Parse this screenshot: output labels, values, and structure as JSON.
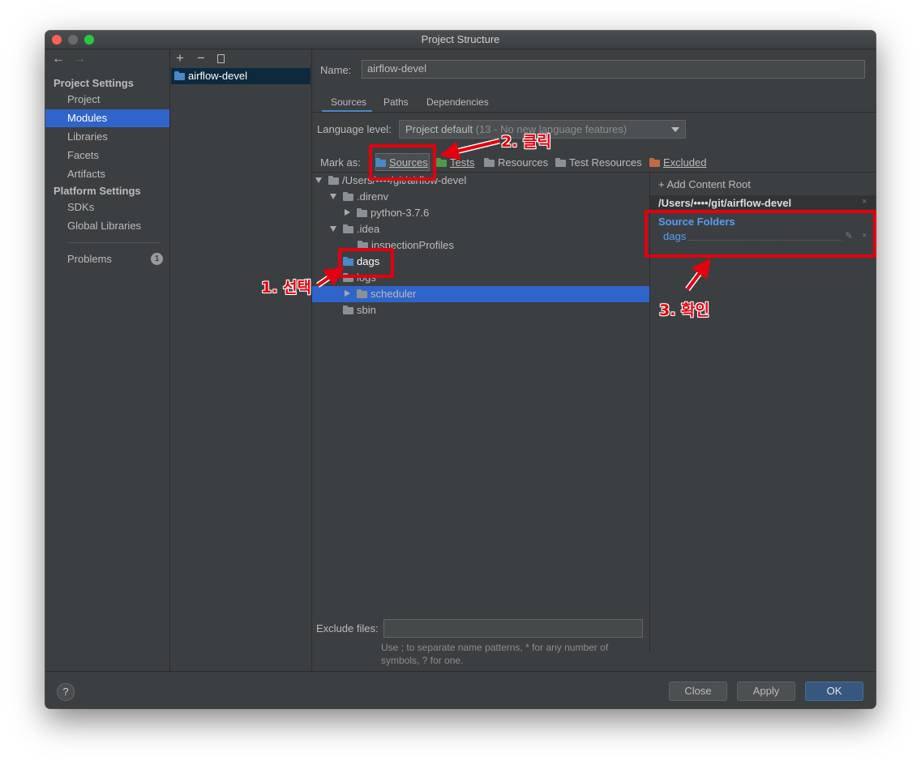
{
  "window": {
    "title": "Project Structure"
  },
  "nav": {
    "back": "←",
    "forward": "→"
  },
  "sidebar": {
    "project_settings_label": "Project Settings",
    "platform_settings_label": "Platform Settings",
    "items": [
      {
        "label": "Project"
      },
      {
        "label": "Modules"
      },
      {
        "label": "Libraries"
      },
      {
        "label": "Facets"
      },
      {
        "label": "Artifacts"
      },
      {
        "label": "SDKs"
      },
      {
        "label": "Global Libraries"
      },
      {
        "label": "Problems"
      }
    ],
    "problems_count": "1"
  },
  "modules": {
    "toolbar": {
      "add": "+",
      "remove": "−"
    },
    "items": [
      {
        "label": "airflow-devel"
      }
    ]
  },
  "module_settings": {
    "name_label": "Name:",
    "name_value": "airflow-devel",
    "tabs": [
      {
        "label": "Sources"
      },
      {
        "label": "Paths"
      },
      {
        "label": "Dependencies"
      }
    ],
    "language_level_label": "Language level:",
    "language_level_value": "Project default",
    "language_level_hint": " (13 - No new language features)",
    "mark_as_label": "Mark as:",
    "mark_as": [
      {
        "label": "Sources",
        "color": "#4a88c7"
      },
      {
        "label": "Tests",
        "color": "#4f9a4a"
      },
      {
        "label": "Resources",
        "color": "#8b9196"
      },
      {
        "label": "Test Resources",
        "color": "#8b9196"
      },
      {
        "label": "Excluded",
        "color": "#c26b3e"
      }
    ],
    "tree": [
      {
        "label": "/Users/••••/git/airflow-devel"
      },
      {
        "label": ".direnv"
      },
      {
        "label": "python-3.7.6"
      },
      {
        "label": ".idea"
      },
      {
        "label": "inspectionProfiles"
      },
      {
        "label": "dags"
      },
      {
        "label": "logs"
      },
      {
        "label": "scheduler"
      },
      {
        "label": "sbin"
      }
    ],
    "exclude_label": "Exclude files:",
    "exclude_value": "",
    "exclude_hint": "Use ; to separate name patterns, * for any number of symbols, ? for one."
  },
  "content_root": {
    "add_label": "+ Add Content Root",
    "path": "/Users/••••/git/airflow-devel",
    "source_folders_title": "Source Folders",
    "source_folders": [
      {
        "label": "dags"
      }
    ],
    "close_glyph": "×",
    "edit_glyph": "✎"
  },
  "footer": {
    "help": "?",
    "close": "Close",
    "apply": "Apply",
    "ok": "OK"
  },
  "annotations": {
    "step1": "1. 선택",
    "step2": "2. 클릭",
    "step3": "3. 확인",
    "color": "#e3000f"
  }
}
